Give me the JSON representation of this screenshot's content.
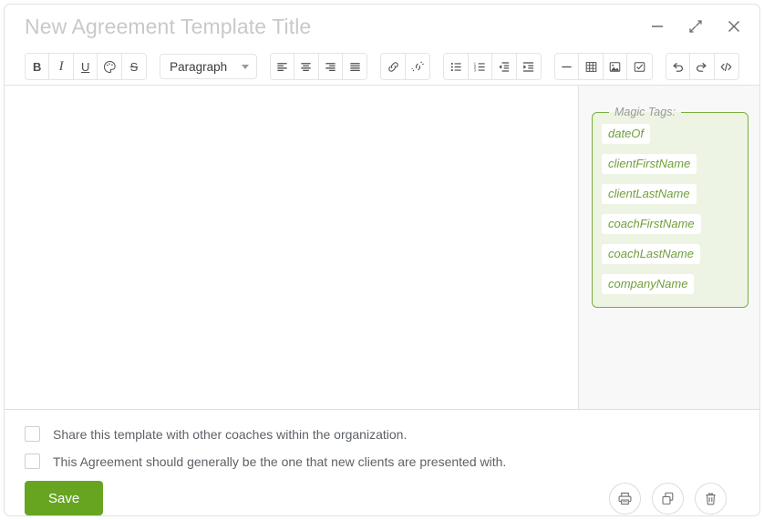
{
  "window": {
    "title_placeholder": "New Agreement Template Title",
    "controls": [
      {
        "name": "minimize-button",
        "icon": "minimize-icon",
        "label": "—"
      },
      {
        "name": "restore-button",
        "icon": "collapse-arrows-icon",
        "label": "⤵"
      },
      {
        "name": "close-button",
        "icon": "close-icon",
        "label": "✕"
      }
    ]
  },
  "toolbar": {
    "groups": [
      {
        "name": "text-format-group",
        "buttons": [
          {
            "name": "bold-button",
            "icon": "bold-icon",
            "label": "B"
          },
          {
            "name": "italic-button",
            "icon": "italic-icon",
            "label": "I"
          },
          {
            "name": "underline-button",
            "icon": "underline-icon",
            "label": "U"
          },
          {
            "name": "text-color-button",
            "icon": "palette-icon",
            "label": ""
          },
          {
            "name": "strikethrough-button",
            "icon": "strikethrough-icon",
            "label": "S"
          }
        ]
      },
      {
        "name": "align-group",
        "buttons": [
          {
            "name": "align-left-button",
            "icon": "align-left-icon",
            "label": ""
          },
          {
            "name": "align-center-button",
            "icon": "align-center-icon",
            "label": ""
          },
          {
            "name": "align-right-button",
            "icon": "align-right-icon",
            "label": ""
          },
          {
            "name": "align-justify-button",
            "icon": "align-justify-icon",
            "label": ""
          }
        ]
      },
      {
        "name": "link-group",
        "buttons": [
          {
            "name": "insert-link-button",
            "icon": "link-icon",
            "label": ""
          },
          {
            "name": "remove-link-button",
            "icon": "unlink-icon",
            "label": ""
          }
        ]
      },
      {
        "name": "list-group",
        "buttons": [
          {
            "name": "bullet-list-button",
            "icon": "bullet-list-icon",
            "label": ""
          },
          {
            "name": "numbered-list-button",
            "icon": "numbered-list-icon",
            "label": ""
          },
          {
            "name": "decrease-indent-button",
            "icon": "outdent-icon",
            "label": ""
          },
          {
            "name": "increase-indent-button",
            "icon": "indent-icon",
            "label": ""
          }
        ]
      },
      {
        "name": "insert-group",
        "buttons": [
          {
            "name": "horizontal-rule-button",
            "icon": "horizontal-rule-icon",
            "label": ""
          },
          {
            "name": "insert-table-button",
            "icon": "table-icon",
            "label": ""
          },
          {
            "name": "insert-image-button",
            "icon": "image-icon",
            "label": ""
          },
          {
            "name": "insert-checkbox-button",
            "icon": "checkbox-icon",
            "label": ""
          }
        ]
      },
      {
        "name": "history-group",
        "buttons": [
          {
            "name": "undo-button",
            "icon": "undo-icon",
            "label": ""
          },
          {
            "name": "redo-button",
            "icon": "redo-icon",
            "label": ""
          },
          {
            "name": "source-code-button",
            "icon": "code-icon",
            "label": ""
          }
        ]
      }
    ],
    "paragraph_select": {
      "name": "paragraph-style-select",
      "value": "Paragraph"
    }
  },
  "editor": {
    "content": ""
  },
  "magic_tags": {
    "legend": "Magic Tags:",
    "border_color": "#7aad3f",
    "background_color": "#edf4e4",
    "chip_text_color": "#6f9f3a",
    "tags": [
      "dateOf",
      "clientFirstName",
      "clientLastName",
      "coachFirstName",
      "coachLastName",
      "companyName"
    ]
  },
  "footer": {
    "checkboxes": [
      {
        "name": "share-template-checkbox",
        "label": "Share this template with other coaches within the organization.",
        "checked": false
      },
      {
        "name": "default-agreement-checkbox",
        "label": "This Agreement should generally be the one that new clients are presented with.",
        "checked": false
      }
    ],
    "save_label": "Save",
    "save_color": "#67a521",
    "actions": [
      {
        "name": "print-button",
        "icon": "printer-icon"
      },
      {
        "name": "duplicate-button",
        "icon": "copy-icon"
      },
      {
        "name": "delete-button",
        "icon": "trash-icon"
      }
    ]
  }
}
